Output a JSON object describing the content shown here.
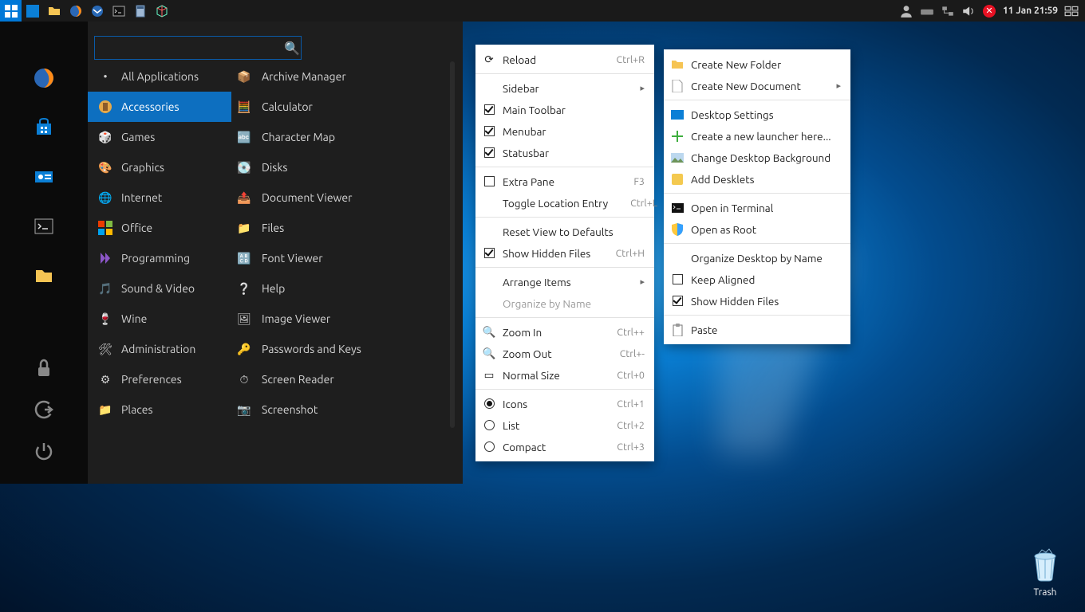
{
  "tray": {
    "datetime": "11 Jan 21:59"
  },
  "search": {
    "value": "",
    "placeholder": ""
  },
  "categories": [
    {
      "label": "All Applications",
      "active": false
    },
    {
      "label": "Accessories",
      "active": true
    },
    {
      "label": "Games",
      "active": false
    },
    {
      "label": "Graphics",
      "active": false
    },
    {
      "label": "Internet",
      "active": false
    },
    {
      "label": "Office",
      "active": false
    },
    {
      "label": "Programming",
      "active": false
    },
    {
      "label": "Sound & Video",
      "active": false
    },
    {
      "label": "Wine",
      "active": false
    },
    {
      "label": "Administration",
      "active": false
    },
    {
      "label": "Preferences",
      "active": false
    },
    {
      "label": "Places",
      "active": false
    }
  ],
  "apps": [
    {
      "label": "Archive Manager"
    },
    {
      "label": "Calculator"
    },
    {
      "label": "Character Map"
    },
    {
      "label": "Disks"
    },
    {
      "label": "Document Viewer"
    },
    {
      "label": "Files"
    },
    {
      "label": "Font Viewer"
    },
    {
      "label": "Help"
    },
    {
      "label": "Image Viewer"
    },
    {
      "label": "Passwords and Keys"
    },
    {
      "label": "Screen Reader"
    },
    {
      "label": "Screenshot"
    }
  ],
  "viewmenu": {
    "reload": {
      "label": "Reload",
      "accel": "Ctrl+R"
    },
    "sidebar": {
      "label": "Sidebar"
    },
    "main_toolbar": {
      "label": "Main Toolbar"
    },
    "menubar": {
      "label": "Menubar"
    },
    "statusbar": {
      "label": "Statusbar"
    },
    "extra_pane": {
      "label": "Extra Pane",
      "accel": "F3"
    },
    "toggle_location": {
      "label": "Toggle Location Entry",
      "accel": "Ctrl+L"
    },
    "reset_defaults": {
      "label": "Reset View to Defaults"
    },
    "show_hidden": {
      "label": "Show Hidden Files",
      "accel": "Ctrl+H"
    },
    "arrange": {
      "label": "Arrange Items"
    },
    "organize_by_name": {
      "label": "Organize by Name"
    },
    "zoom_in": {
      "label": "Zoom In",
      "accel": "Ctrl++"
    },
    "zoom_out": {
      "label": "Zoom Out",
      "accel": "Ctrl+-"
    },
    "normal_size": {
      "label": "Normal Size",
      "accel": "Ctrl+0"
    },
    "icons": {
      "label": "Icons",
      "accel": "Ctrl+1"
    },
    "list": {
      "label": "List",
      "accel": "Ctrl+2"
    },
    "compact": {
      "label": "Compact",
      "accel": "Ctrl+3"
    }
  },
  "deskmenu": {
    "new_folder": {
      "label": "Create New Folder"
    },
    "new_document": {
      "label": "Create New Document"
    },
    "desktop_settings": {
      "label": "Desktop Settings"
    },
    "new_launcher": {
      "label": "Create a new launcher here..."
    },
    "change_bg": {
      "label": "Change Desktop Background"
    },
    "add_desklets": {
      "label": "Add Desklets"
    },
    "open_terminal": {
      "label": "Open in Terminal"
    },
    "open_root": {
      "label": "Open as Root"
    },
    "organize": {
      "label": "Organize Desktop by Name"
    },
    "keep_aligned": {
      "label": "Keep Aligned"
    },
    "show_hidden": {
      "label": "Show Hidden Files"
    },
    "paste": {
      "label": "Paste"
    }
  },
  "trash": {
    "label": "Trash"
  }
}
